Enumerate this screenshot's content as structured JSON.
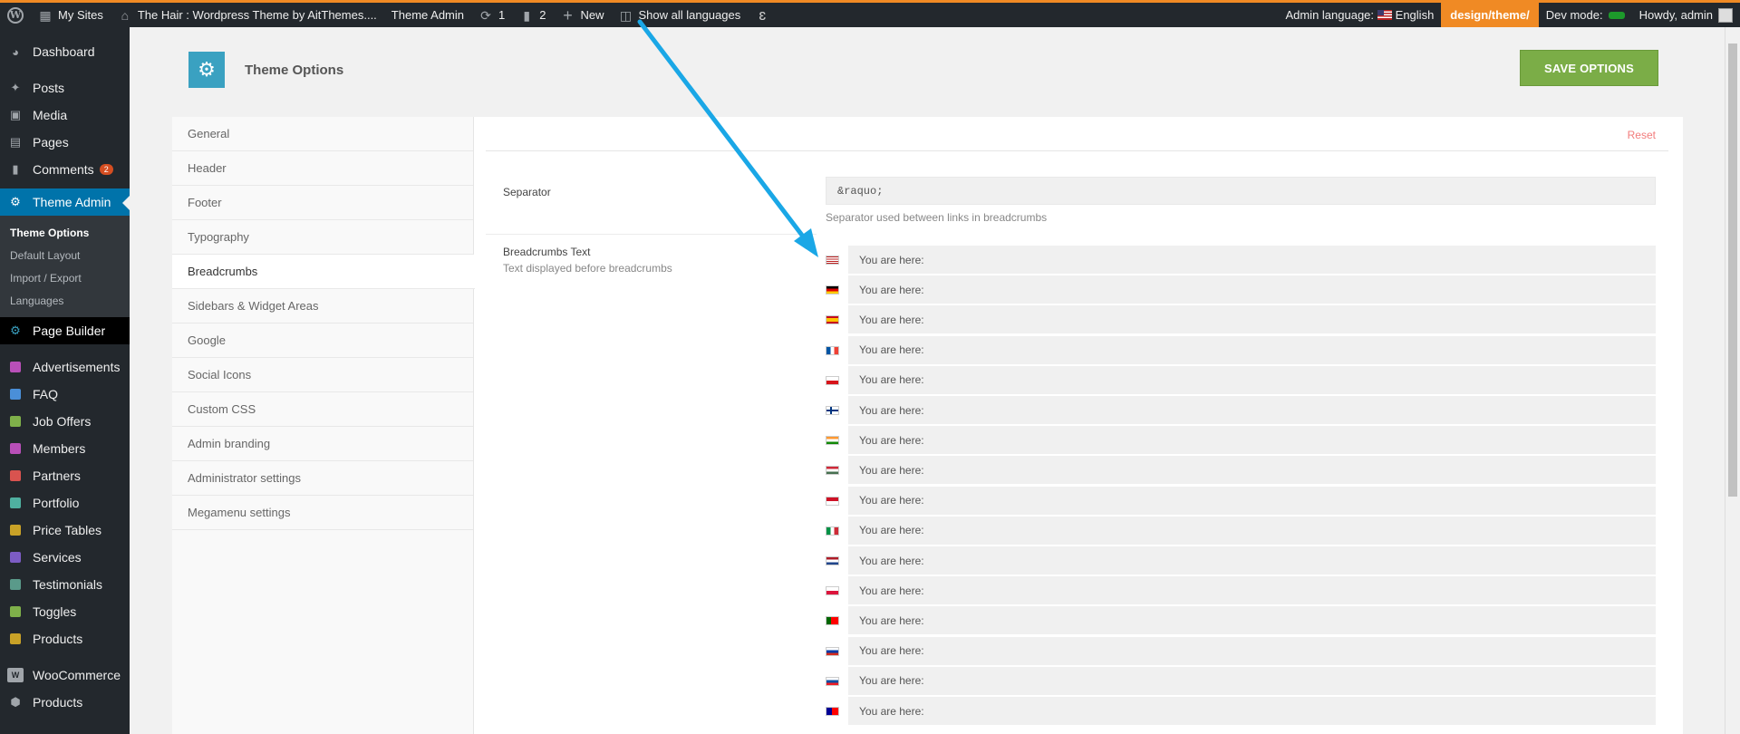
{
  "adminbar": {
    "my_sites": "My Sites",
    "site_name": "The Hair : Wordpress Theme by AitThemes....",
    "theme_admin": "Theme Admin",
    "updates_count": "1",
    "comments_count": "2",
    "new_label": "New",
    "show_all_languages": "Show all languages",
    "admin_language_label": "Admin language:",
    "admin_language_value": "English",
    "design_path": "design/theme/",
    "dev_mode_label": "Dev mode:",
    "howdy": "Howdy, admin"
  },
  "sidebar": {
    "items": [
      {
        "label": "Dashboard",
        "icon": "dashboard-icon"
      },
      {
        "label": "Posts",
        "icon": "pin-icon"
      },
      {
        "label": "Media",
        "icon": "media-icon"
      },
      {
        "label": "Pages",
        "icon": "pages-icon"
      },
      {
        "label": "Comments",
        "icon": "comment-icon",
        "badge": "2"
      },
      {
        "label": "Theme Admin",
        "icon": "theme-admin-icon"
      }
    ],
    "submenu": [
      "Theme Options",
      "Default Layout",
      "Import / Export",
      "Languages"
    ],
    "page_builder": "Page Builder",
    "cpt_items": [
      {
        "label": "Advertisements",
        "color": "#b84fb8"
      },
      {
        "label": "FAQ",
        "color": "#4a8fd8"
      },
      {
        "label": "Job Offers",
        "color": "#7fb04a"
      },
      {
        "label": "Members",
        "color": "#b84fb8"
      },
      {
        "label": "Partners",
        "color": "#d9534f"
      },
      {
        "label": "Portfolio",
        "color": "#4fb0a0"
      },
      {
        "label": "Price Tables",
        "color": "#c9a227"
      },
      {
        "label": "Services",
        "color": "#7c5cc4"
      },
      {
        "label": "Testimonials",
        "color": "#5a9a8a"
      },
      {
        "label": "Toggles",
        "color": "#7fb04a"
      },
      {
        "label": "Products",
        "color": "#c9a227"
      }
    ],
    "woocommerce": "WooCommerce",
    "woo_products": "Products"
  },
  "header": {
    "title": "Theme Options",
    "save_label": "SAVE OPTIONS"
  },
  "tabs": [
    "General",
    "Header",
    "Footer",
    "Typography",
    "Breadcrumbs",
    "Sidebars & Widget Areas",
    "Google",
    "Social Icons",
    "Custom CSS",
    "Admin branding",
    "Administrator settings",
    "Megamenu settings"
  ],
  "content": {
    "reset": "Reset",
    "separator_label": "Separator",
    "separator_value": "&raquo;",
    "separator_desc": "Separator used between links in breadcrumbs",
    "bc_label": "Breadcrumbs Text",
    "bc_desc": "Text displayed before breadcrumbs",
    "bc_rows": [
      {
        "flag": "us",
        "value": "You are here:"
      },
      {
        "flag": "de",
        "value": "You are here:"
      },
      {
        "flag": "es",
        "value": "You are here:"
      },
      {
        "flag": "fr",
        "value": "You are here:"
      },
      {
        "flag": "cz",
        "value": "You are here:"
      },
      {
        "flag": "fi",
        "value": "You are here:"
      },
      {
        "flag": "in",
        "value": "You are here:"
      },
      {
        "flag": "hu",
        "value": "You are here:"
      },
      {
        "flag": "id",
        "value": "You are here:"
      },
      {
        "flag": "it",
        "value": "You are here:"
      },
      {
        "flag": "nl",
        "value": "You are here:"
      },
      {
        "flag": "pl",
        "value": "You are here:"
      },
      {
        "flag": "pt",
        "value": "You are here:"
      },
      {
        "flag": "ru",
        "value": "You are here:"
      },
      {
        "flag": "sk",
        "value": "You are here:"
      },
      {
        "flag": "tw",
        "value": "You are here:"
      }
    ]
  },
  "colors": {
    "accent": "#0073aa",
    "save_button": "#7bad47",
    "annotation_arrow": "#1aa7e6",
    "design_badge": "#f08a24"
  }
}
